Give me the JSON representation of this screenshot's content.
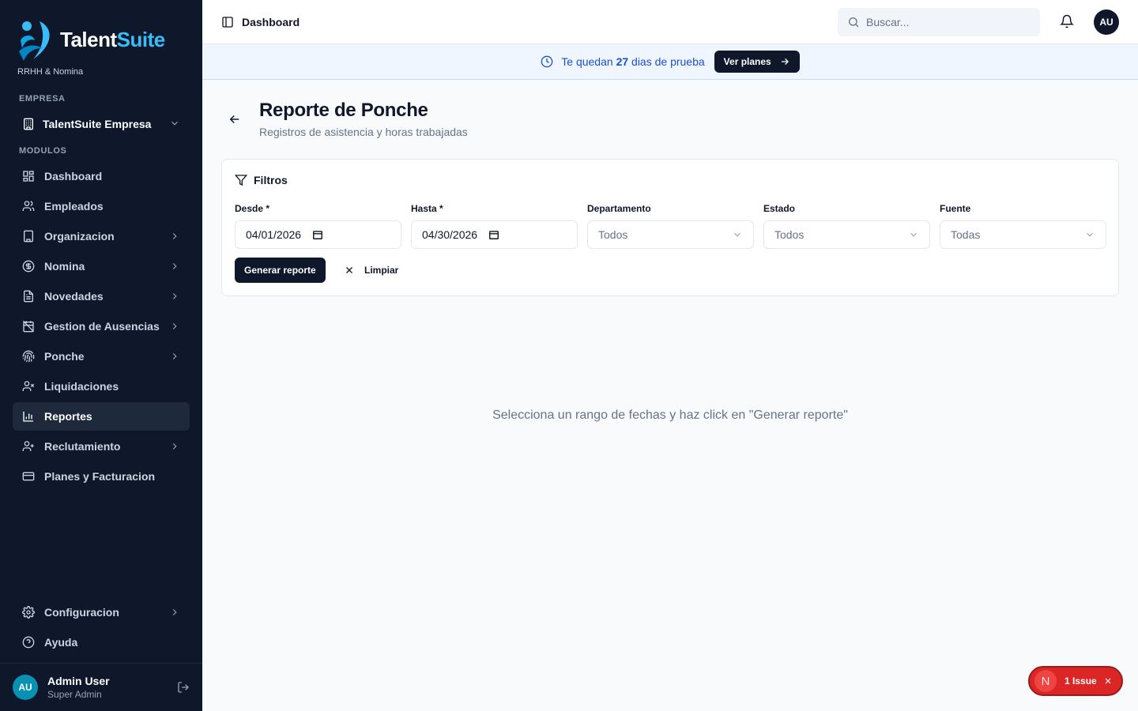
{
  "brand": {
    "name_a": "Talent",
    "name_b": "Suite",
    "subtitle": "RRHH & Nomina",
    "accent": "#38bdf8"
  },
  "sidebar": {
    "company_label": "EMPRESA",
    "company_name": "TalentSuite Empresa",
    "modules_label": "MODULOS",
    "items": [
      {
        "label": "Dashboard",
        "icon": "layout-grid-icon"
      },
      {
        "label": "Empleados",
        "icon": "users-icon"
      },
      {
        "label": "Organizacion",
        "icon": "building-icon"
      },
      {
        "label": "Nomina",
        "icon": "dollar-circle-icon"
      },
      {
        "label": "Novedades",
        "icon": "file-text-icon"
      },
      {
        "label": "Gestion de Ausencias",
        "icon": "calendar-off-icon"
      },
      {
        "label": "Ponche",
        "icon": "fingerprint-icon"
      },
      {
        "label": "Liquidaciones",
        "icon": "user-x-icon"
      },
      {
        "label": "Reportes",
        "icon": "bar-chart-icon"
      },
      {
        "label": "Reclutamiento",
        "icon": "user-plus-icon"
      },
      {
        "label": "Planes y Facturacion",
        "icon": "credit-card-icon"
      }
    ],
    "bottom_items": [
      {
        "label": "Configuracion",
        "icon": "gear-icon"
      },
      {
        "label": "Ayuda",
        "icon": "help-circle-icon"
      }
    ],
    "user": {
      "initials": "AU",
      "name": "Admin User",
      "role": "Super Admin"
    }
  },
  "topbar": {
    "breadcrumb": "Dashboard",
    "search_placeholder": "Buscar...",
    "avatar_initials": "AU"
  },
  "banner": {
    "prefix": "Te quedan ",
    "days": "27",
    "suffix": " dias de prueba",
    "button": "Ver planes"
  },
  "page": {
    "title": "Reporte de Ponche",
    "subtitle": "Registros de asistencia y horas trabajadas"
  },
  "filters": {
    "title": "Filtros",
    "desde_label": "Desde *",
    "desde_value": "04/01/2026",
    "hasta_label": "Hasta *",
    "hasta_value": "04/30/2026",
    "departamento_label": "Departamento",
    "departamento_value": "Todos",
    "estado_label": "Estado",
    "estado_value": "Todos",
    "fuente_label": "Fuente",
    "fuente_value": "Todas",
    "generate_button": "Generar reporte",
    "clear_button": "Limpiar"
  },
  "empty_message": "Selecciona un rango de fechas y haz click en \"Generar reporte\"",
  "issue": {
    "letter": "N",
    "label": "1 Issue"
  }
}
